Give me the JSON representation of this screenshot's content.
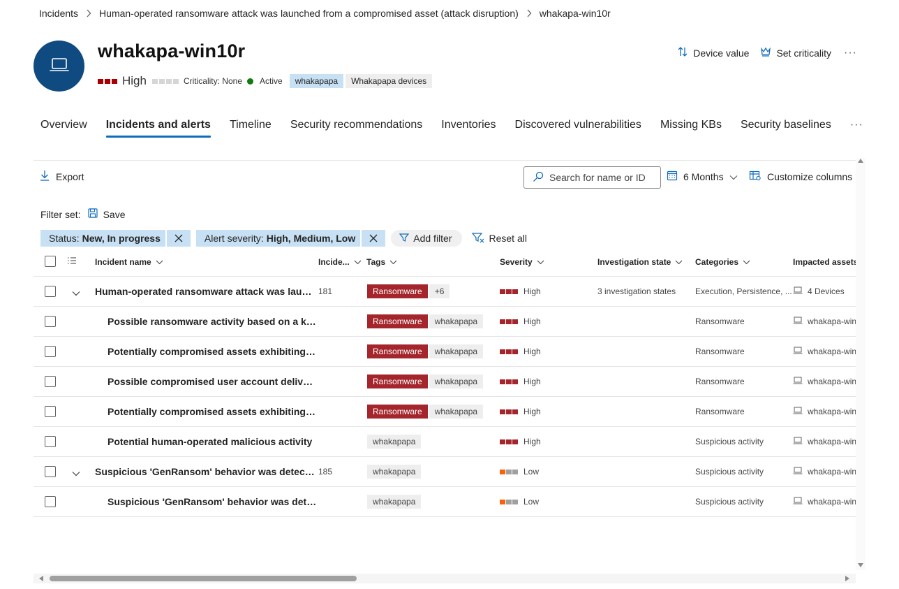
{
  "breadcrumb": {
    "items": [
      "Incidents",
      "Human-operated ransomware attack was launched from a compromised asset (attack disruption)",
      "whakapa-win10r"
    ]
  },
  "device": {
    "name": "whakapa-win10r",
    "risk_label": "High",
    "risk_color": "#a80000",
    "criticality": "Criticality: None",
    "status": "Active",
    "status_color": "#107c10",
    "tags": [
      "whakapapa",
      "Whakapapa devices"
    ],
    "avatar_icon": "laptop-icon",
    "avatar_color": "#0f4a80"
  },
  "header_actions": {
    "device_value": "Device value",
    "set_criticality": "Set criticality",
    "more": "···"
  },
  "tabs": [
    {
      "label": "Overview",
      "active": false
    },
    {
      "label": "Incidents and alerts",
      "active": true
    },
    {
      "label": "Timeline",
      "active": false
    },
    {
      "label": "Security recommendations",
      "active": false
    },
    {
      "label": "Inventories",
      "active": false
    },
    {
      "label": "Discovered vulnerabilities",
      "active": false
    },
    {
      "label": "Missing KBs",
      "active": false
    },
    {
      "label": "Security baselines",
      "active": false
    }
  ],
  "tabs_more": "···",
  "toolbar": {
    "export": "Export",
    "search_placeholder": "Search for name or ID",
    "time_range": "6 Months",
    "customize_columns": "Customize columns"
  },
  "filters": {
    "filter_set_label": "Filter set:",
    "save": "Save",
    "chips": [
      {
        "key": "Status:",
        "value": "New, In progress"
      },
      {
        "key": "Alert severity:",
        "value": "High, Medium, Low"
      }
    ],
    "add_filter": "Add filter",
    "reset_all": "Reset all"
  },
  "table": {
    "columns": [
      "Incident name",
      "Incide...",
      "Tags",
      "Severity",
      "Investigation state",
      "Categories",
      "Impacted assets"
    ],
    "rows": [
      {
        "level": 0,
        "expandable": true,
        "name": "Human-operated ransomware attack was launc...",
        "id": "181",
        "tag_red": "Ransomware",
        "tag_gray": "+6",
        "severity": "High",
        "sev_colors": [
          "#a4262c",
          "#a4262c",
          "#a4262c"
        ],
        "investigation": "3 investigation states",
        "category": "Execution, Persistence, ...",
        "asset": "4 Devices"
      },
      {
        "level": 1,
        "expandable": false,
        "name": "Possible ransomware activity based on a kno...",
        "id": "",
        "tag_red": "Ransomware",
        "tag_gray": "whakapapa",
        "severity": "High",
        "sev_colors": [
          "#a4262c",
          "#a4262c",
          "#a4262c"
        ],
        "investigation": "",
        "category": "Ransomware",
        "asset": "whakapa-win"
      },
      {
        "level": 1,
        "expandable": false,
        "name": "Potentially compromised assets exhibiting ra...",
        "id": "",
        "tag_red": "Ransomware",
        "tag_gray": "whakapapa",
        "severity": "High",
        "sev_colors": [
          "#a4262c",
          "#a4262c",
          "#a4262c"
        ],
        "investigation": "",
        "category": "Ransomware",
        "asset": "whakapa-win"
      },
      {
        "level": 1,
        "expandable": false,
        "name": "Possible compromised user account deliveri...",
        "id": "",
        "tag_red": "Ransomware",
        "tag_gray": "whakapapa",
        "severity": "High",
        "sev_colors": [
          "#a4262c",
          "#a4262c",
          "#a4262c"
        ],
        "investigation": "",
        "category": "Ransomware",
        "asset": "whakapa-win"
      },
      {
        "level": 1,
        "expandable": false,
        "name": "Potentially compromised assets exhibiting ra...",
        "id": "",
        "tag_red": "Ransomware",
        "tag_gray": "whakapapa",
        "severity": "High",
        "sev_colors": [
          "#a4262c",
          "#a4262c",
          "#a4262c"
        ],
        "investigation": "",
        "category": "Ransomware",
        "asset": "whakapa-win"
      },
      {
        "level": 1,
        "expandable": false,
        "name": "Potential human-operated malicious activity",
        "id": "",
        "tag_red": "",
        "tag_gray": "whakapapa",
        "severity": "High",
        "sev_colors": [
          "#a4262c",
          "#a4262c",
          "#a4262c"
        ],
        "investigation": "",
        "category": "Suspicious activity",
        "asset": "whakapa-win"
      },
      {
        "level": 0,
        "expandable": true,
        "name": "Suspicious 'GenRansom' behavior was detected...",
        "id": "185",
        "tag_red": "",
        "tag_gray": "whakapapa",
        "severity": "Low",
        "sev_colors": [
          "#f7630c",
          "#a0a0a0",
          "#a0a0a0"
        ],
        "investigation": "",
        "category": "Suspicious activity",
        "asset": "whakapa-win"
      },
      {
        "level": 1,
        "expandable": false,
        "name": "Suspicious 'GenRansom' behavior was detect...",
        "id": "",
        "tag_red": "",
        "tag_gray": "whakapapa",
        "severity": "Low",
        "sev_colors": [
          "#f7630c",
          "#a0a0a0",
          "#a0a0a0"
        ],
        "investigation": "",
        "category": "Suspicious activity",
        "asset": "whakapa-win"
      }
    ]
  },
  "colors": {
    "accent": "#0f6cbd",
    "chip_bg": "#c7e0f4",
    "ransomware_red": "#a4262c"
  }
}
